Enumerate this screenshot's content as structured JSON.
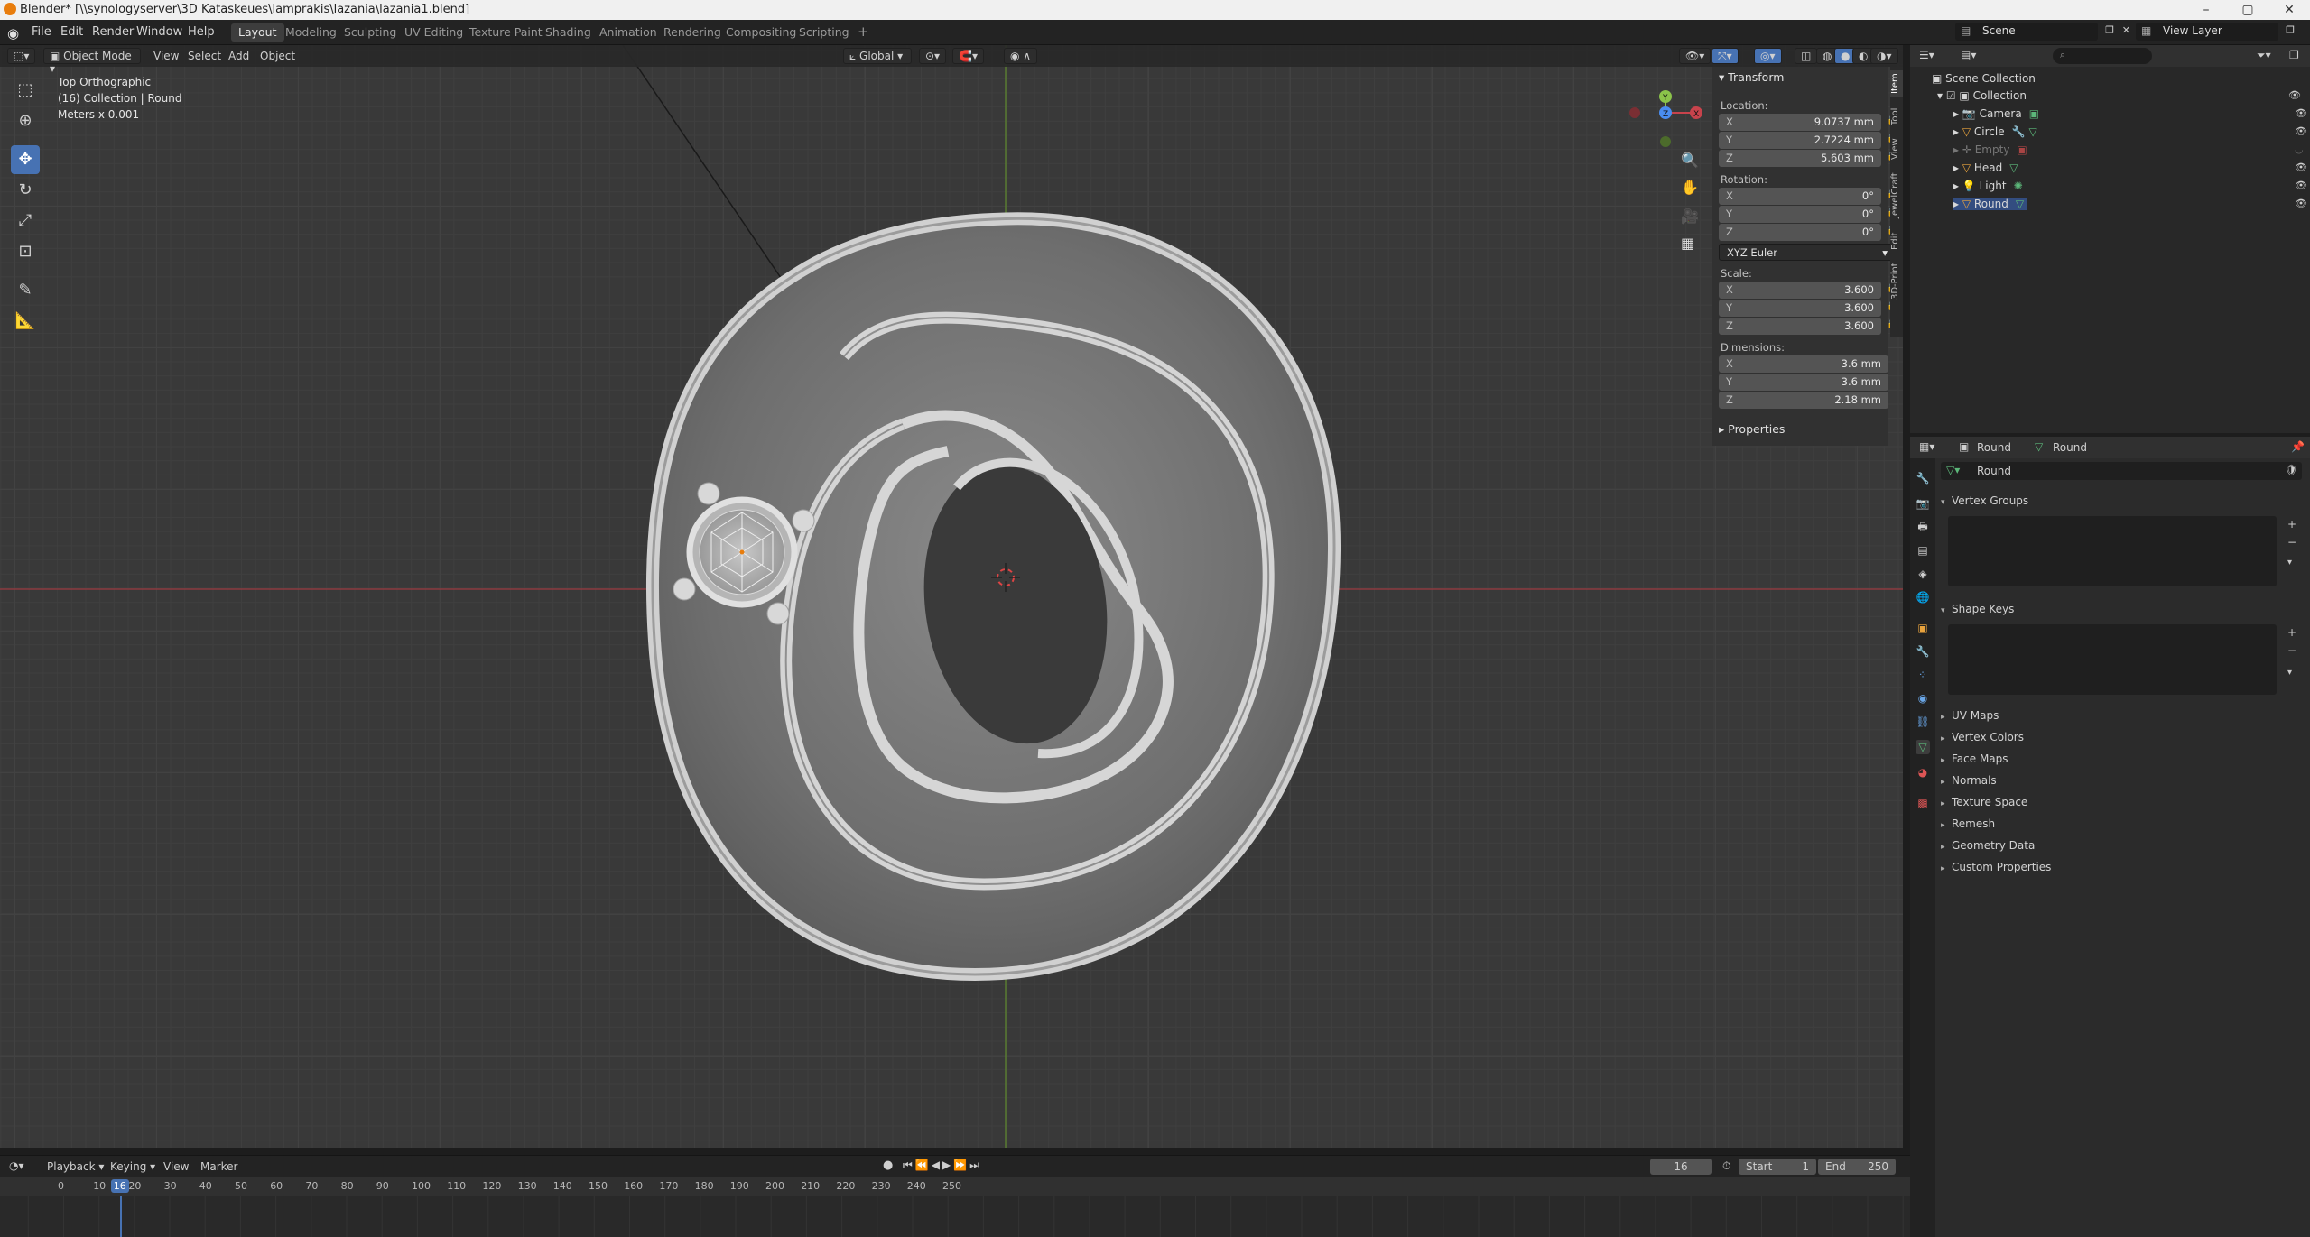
{
  "window": {
    "title": "Blender* [\\\\synologyserver\\3D Kataskeues\\lamprakis\\lazania\\lazania1.blend]",
    "minimize": "–",
    "maximize": "▢",
    "close": "✕"
  },
  "menu": [
    "File",
    "Edit",
    "Render",
    "Window",
    "Help"
  ],
  "workspaces": [
    "Layout",
    "Modeling",
    "Sculpting",
    "UV Editing",
    "Texture Paint",
    "Shading",
    "Animation",
    "Rendering",
    "Compositing",
    "Scripting"
  ],
  "active_workspace": "Layout",
  "scene": {
    "label": "Scene",
    "view_layer": "View Layer"
  },
  "viewport_header": {
    "mode": "Object Mode",
    "menus": [
      "View",
      "Select",
      "Add",
      "Object"
    ],
    "orientation": "Global"
  },
  "viewport_info": {
    "view": "Top Orthographic",
    "collection": "(16) Collection | Round",
    "units": "Meters x 0.001"
  },
  "npanel": {
    "tabs": [
      "Item",
      "Tool",
      "View",
      "JewelCraft",
      "Edit",
      "3D-Print"
    ],
    "transform_title": "Transform",
    "location_label": "Location:",
    "location": [
      {
        "axis": "X",
        "value": "9.0737 mm"
      },
      {
        "axis": "Y",
        "value": "2.7224 mm"
      },
      {
        "axis": "Z",
        "value": "5.603 mm"
      }
    ],
    "rotation_label": "Rotation:",
    "rotation": [
      {
        "axis": "X",
        "value": "0°"
      },
      {
        "axis": "Y",
        "value": "0°"
      },
      {
        "axis": "Z",
        "value": "0°"
      }
    ],
    "rotation_mode": "XYZ Euler",
    "scale_label": "Scale:",
    "scale": [
      {
        "axis": "X",
        "value": "3.600"
      },
      {
        "axis": "Y",
        "value": "3.600"
      },
      {
        "axis": "Z",
        "value": "3.600"
      }
    ],
    "dimensions_label": "Dimensions:",
    "dimensions": [
      {
        "axis": "X",
        "value": "3.6 mm"
      },
      {
        "axis": "Y",
        "value": "3.6 mm"
      },
      {
        "axis": "Z",
        "value": "2.18 mm"
      }
    ],
    "properties_title": "Properties"
  },
  "outliner": {
    "root": "Scene Collection",
    "collection": "Collection",
    "items": [
      "Camera",
      "Circle",
      "Empty",
      "Head",
      "Light",
      "Round"
    ]
  },
  "properties": {
    "object_name": "Round",
    "data_name": "Round",
    "mesh_field": "Round",
    "sections_open": [
      "Vertex Groups",
      "Shape Keys"
    ],
    "sections_closed": [
      "UV Maps",
      "Vertex Colors",
      "Face Maps",
      "Normals",
      "Texture Space",
      "Remesh",
      "Geometry Data",
      "Custom Properties"
    ]
  },
  "timeline": {
    "menus": [
      "Playback",
      "Keying",
      "View",
      "Marker"
    ],
    "current_frame": "16",
    "start_label": "Start",
    "start": "1",
    "end_label": "End",
    "end": "250",
    "ticks": [
      "0",
      "10",
      "20",
      "30",
      "40",
      "50",
      "60",
      "70",
      "80",
      "90",
      "100",
      "110",
      "120",
      "130",
      "140",
      "150",
      "160",
      "170",
      "180",
      "190",
      "200",
      "210",
      "220",
      "230",
      "240",
      "250"
    ]
  },
  "colors": {
    "accent": "#4772b3",
    "x_axis": "#c8434c",
    "y_axis": "#8bc34a",
    "z_axis": "#4a8df0"
  }
}
